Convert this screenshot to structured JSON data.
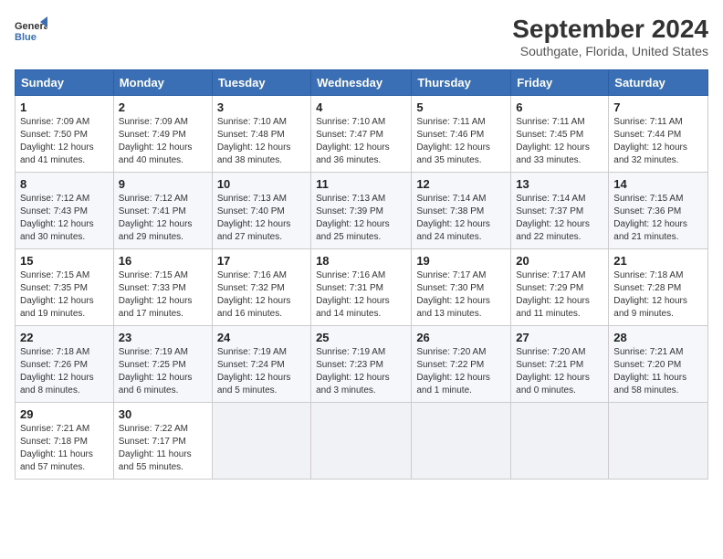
{
  "header": {
    "logo_line1": "General",
    "logo_line2": "Blue",
    "title": "September 2024",
    "subtitle": "Southgate, Florida, United States"
  },
  "weekdays": [
    "Sunday",
    "Monday",
    "Tuesday",
    "Wednesday",
    "Thursday",
    "Friday",
    "Saturday"
  ],
  "weeks": [
    [
      {
        "day": "1",
        "info": "Sunrise: 7:09 AM\nSunset: 7:50 PM\nDaylight: 12 hours\nand 41 minutes."
      },
      {
        "day": "2",
        "info": "Sunrise: 7:09 AM\nSunset: 7:49 PM\nDaylight: 12 hours\nand 40 minutes."
      },
      {
        "day": "3",
        "info": "Sunrise: 7:10 AM\nSunset: 7:48 PM\nDaylight: 12 hours\nand 38 minutes."
      },
      {
        "day": "4",
        "info": "Sunrise: 7:10 AM\nSunset: 7:47 PM\nDaylight: 12 hours\nand 36 minutes."
      },
      {
        "day": "5",
        "info": "Sunrise: 7:11 AM\nSunset: 7:46 PM\nDaylight: 12 hours\nand 35 minutes."
      },
      {
        "day": "6",
        "info": "Sunrise: 7:11 AM\nSunset: 7:45 PM\nDaylight: 12 hours\nand 33 minutes."
      },
      {
        "day": "7",
        "info": "Sunrise: 7:11 AM\nSunset: 7:44 PM\nDaylight: 12 hours\nand 32 minutes."
      }
    ],
    [
      {
        "day": "8",
        "info": "Sunrise: 7:12 AM\nSunset: 7:43 PM\nDaylight: 12 hours\nand 30 minutes."
      },
      {
        "day": "9",
        "info": "Sunrise: 7:12 AM\nSunset: 7:41 PM\nDaylight: 12 hours\nand 29 minutes."
      },
      {
        "day": "10",
        "info": "Sunrise: 7:13 AM\nSunset: 7:40 PM\nDaylight: 12 hours\nand 27 minutes."
      },
      {
        "day": "11",
        "info": "Sunrise: 7:13 AM\nSunset: 7:39 PM\nDaylight: 12 hours\nand 25 minutes."
      },
      {
        "day": "12",
        "info": "Sunrise: 7:14 AM\nSunset: 7:38 PM\nDaylight: 12 hours\nand 24 minutes."
      },
      {
        "day": "13",
        "info": "Sunrise: 7:14 AM\nSunset: 7:37 PM\nDaylight: 12 hours\nand 22 minutes."
      },
      {
        "day": "14",
        "info": "Sunrise: 7:15 AM\nSunset: 7:36 PM\nDaylight: 12 hours\nand 21 minutes."
      }
    ],
    [
      {
        "day": "15",
        "info": "Sunrise: 7:15 AM\nSunset: 7:35 PM\nDaylight: 12 hours\nand 19 minutes."
      },
      {
        "day": "16",
        "info": "Sunrise: 7:15 AM\nSunset: 7:33 PM\nDaylight: 12 hours\nand 17 minutes."
      },
      {
        "day": "17",
        "info": "Sunrise: 7:16 AM\nSunset: 7:32 PM\nDaylight: 12 hours\nand 16 minutes."
      },
      {
        "day": "18",
        "info": "Sunrise: 7:16 AM\nSunset: 7:31 PM\nDaylight: 12 hours\nand 14 minutes."
      },
      {
        "day": "19",
        "info": "Sunrise: 7:17 AM\nSunset: 7:30 PM\nDaylight: 12 hours\nand 13 minutes."
      },
      {
        "day": "20",
        "info": "Sunrise: 7:17 AM\nSunset: 7:29 PM\nDaylight: 12 hours\nand 11 minutes."
      },
      {
        "day": "21",
        "info": "Sunrise: 7:18 AM\nSunset: 7:28 PM\nDaylight: 12 hours\nand 9 minutes."
      }
    ],
    [
      {
        "day": "22",
        "info": "Sunrise: 7:18 AM\nSunset: 7:26 PM\nDaylight: 12 hours\nand 8 minutes."
      },
      {
        "day": "23",
        "info": "Sunrise: 7:19 AM\nSunset: 7:25 PM\nDaylight: 12 hours\nand 6 minutes."
      },
      {
        "day": "24",
        "info": "Sunrise: 7:19 AM\nSunset: 7:24 PM\nDaylight: 12 hours\nand 5 minutes."
      },
      {
        "day": "25",
        "info": "Sunrise: 7:19 AM\nSunset: 7:23 PM\nDaylight: 12 hours\nand 3 minutes."
      },
      {
        "day": "26",
        "info": "Sunrise: 7:20 AM\nSunset: 7:22 PM\nDaylight: 12 hours\nand 1 minute."
      },
      {
        "day": "27",
        "info": "Sunrise: 7:20 AM\nSunset: 7:21 PM\nDaylight: 12 hours\nand 0 minutes."
      },
      {
        "day": "28",
        "info": "Sunrise: 7:21 AM\nSunset: 7:20 PM\nDaylight: 11 hours\nand 58 minutes."
      }
    ],
    [
      {
        "day": "29",
        "info": "Sunrise: 7:21 AM\nSunset: 7:18 PM\nDaylight: 11 hours\nand 57 minutes."
      },
      {
        "day": "30",
        "info": "Sunrise: 7:22 AM\nSunset: 7:17 PM\nDaylight: 11 hours\nand 55 minutes."
      },
      {
        "day": "",
        "info": ""
      },
      {
        "day": "",
        "info": ""
      },
      {
        "day": "",
        "info": ""
      },
      {
        "day": "",
        "info": ""
      },
      {
        "day": "",
        "info": ""
      }
    ]
  ]
}
